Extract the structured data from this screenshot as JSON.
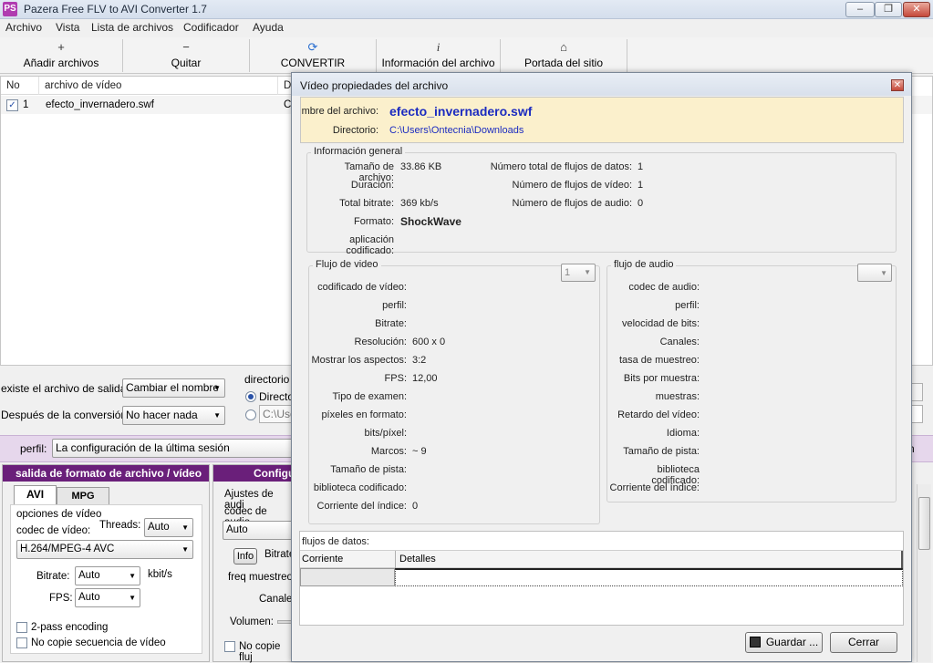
{
  "app": {
    "title": "Pazera Free FLV to AVI Converter 1.7",
    "icon": "PS"
  },
  "window_buttons": {
    "minimize": "–",
    "maximize": "❐",
    "close": "✕"
  },
  "menu": [
    "Archivo",
    "Vista",
    "Lista de archivos",
    "Codificador",
    "Ayuda"
  ],
  "toolbar": [
    {
      "icon": "+",
      "label": "Añadir archivos"
    },
    {
      "icon": "−",
      "label": "Quitar"
    },
    {
      "icon": "⟳",
      "label": "CONVERTIR"
    },
    {
      "icon": "i",
      "label": "Información del archivo"
    },
    {
      "icon": "⌂",
      "label": "Portada del sitio"
    }
  ],
  "filelist": {
    "headers": [
      "No",
      "archivo de vídeo",
      "Di"
    ],
    "rows": [
      {
        "no": "1",
        "file": "efecto_invernadero.swf",
        "dir": "C:"
      }
    ]
  },
  "options": {
    "exists_label": "existe el archivo de salida:",
    "exists_value": "Cambiar el nombre",
    "after_label": "Después de la conversión:",
    "after_value": "No hacer nada",
    "outdir_label": "directorio d",
    "outdir_radio1": "Director",
    "outdir_path": "C:\\Use"
  },
  "perfil": {
    "label": "perfil:",
    "value": "La configuración de la última sesión",
    "right_text": "n"
  },
  "format_panel": {
    "title": "salida de formato de archivo / vídeo",
    "tabs": [
      "AVI",
      "MPG"
    ],
    "group": "opciones de vídeo",
    "codec_label": "codec de vídeo:",
    "codec_value": "H.264/MPEG-4 AVC",
    "threads_label": "Threads:",
    "threads_value": "Auto",
    "bitrate_label": "Bitrate:",
    "bitrate_value": "Auto",
    "bitrate_unit": "kbit/s",
    "fps_label": "FPS:",
    "fps_value": "Auto",
    "twopass": "2-pass encoding",
    "nocopy": "No copie secuencia de vídeo"
  },
  "audio_panel": {
    "title": "Configu",
    "settings": "Ajustes de audi",
    "codec_label": "codec de audio",
    "codec_value": "Auto",
    "info_btn": "Info",
    "bitrate": "Bitrate",
    "freq": "freq muestreo",
    "channels": "Canales",
    "volume": "Volumen:",
    "nocopy": "No copie fluj"
  },
  "dialog": {
    "title": "Vídeo propiedades del archivo",
    "name_label": "mbre del archivo:",
    "name_value": "efecto_invernadero.swf",
    "dir_label": "Directorio:",
    "dir_value": "C:\\Users\\Ontecnia\\Downloads",
    "general": {
      "title": "Información general",
      "left": [
        {
          "k": "Tamaño de archivo:",
          "v": "33.86 KB"
        },
        {
          "k": "Duración:",
          "v": ""
        },
        {
          "k": "Total bitrate:",
          "v": "369 kb/s"
        },
        {
          "k": "Formato:",
          "v": "ShockWave"
        },
        {
          "k": "aplicación codificado:",
          "v": ""
        }
      ],
      "right": [
        {
          "k": "Número total de flujos de datos:",
          "v": "1"
        },
        {
          "k": "Número de flujos de vídeo:",
          "v": "1"
        },
        {
          "k": "Número de flujos de audio:",
          "v": "0"
        }
      ]
    },
    "video": {
      "title": "Flujo de video",
      "select": "1",
      "rows": [
        {
          "k": "codificado de vídeo:",
          "v": ""
        },
        {
          "k": "perfil:",
          "v": ""
        },
        {
          "k": "Bitrate:",
          "v": ""
        },
        {
          "k": "Resolución:",
          "v": "600 x 0"
        },
        {
          "k": "Mostrar los aspectos:",
          "v": "3:2"
        },
        {
          "k": "FPS:",
          "v": "12,00"
        },
        {
          "k": "Tipo de examen:",
          "v": ""
        },
        {
          "k": "píxeles en formato:",
          "v": ""
        },
        {
          "k": "bits/píxel:",
          "v": ""
        },
        {
          "k": "Marcos:",
          "v": "~ 9"
        },
        {
          "k": "Tamaño de pista:",
          "v": ""
        },
        {
          "k": "biblioteca codificado:",
          "v": ""
        },
        {
          "k": "Corriente del índice:",
          "v": "0"
        }
      ]
    },
    "audio": {
      "title": "flujo de audio",
      "select": "",
      "rows": [
        {
          "k": "codec de audio:"
        },
        {
          "k": "perfil:"
        },
        {
          "k": "velocidad de bits:"
        },
        {
          "k": "Canales:"
        },
        {
          "k": "tasa de muestreo:"
        },
        {
          "k": "Bits por muestra:"
        },
        {
          "k": "muestras:"
        },
        {
          "k": "Retardo del vídeo:"
        },
        {
          "k": "Idioma:"
        },
        {
          "k": "Tamaño de pista:"
        },
        {
          "k": "biblioteca codificado:"
        },
        {
          "k": "Corriente del índice:"
        }
      ]
    },
    "streams": {
      "label": "flujos de datos:",
      "headers": [
        "Corriente",
        "Detalles"
      ]
    },
    "save_btn": "Guardar ...",
    "close_btn": "Cerrar"
  }
}
